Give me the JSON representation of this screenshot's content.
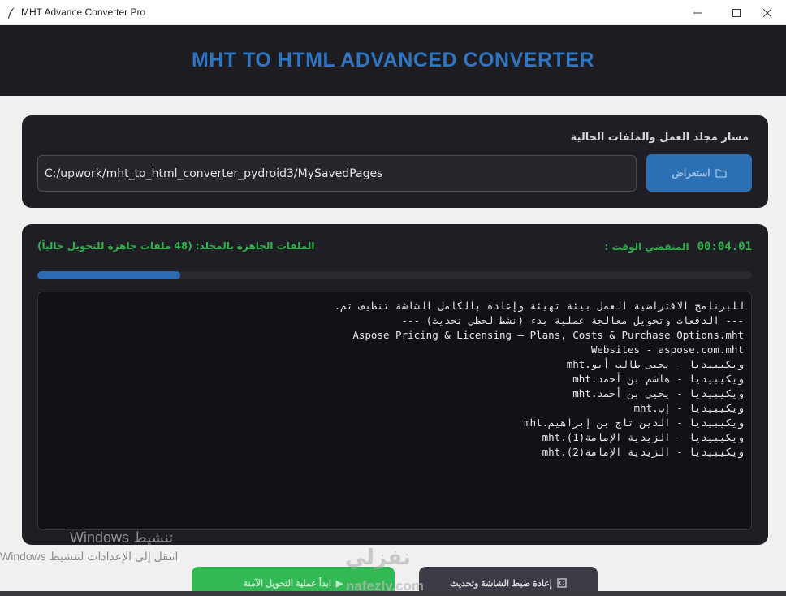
{
  "window": {
    "title": "MHT Advance Converter Pro"
  },
  "header": {
    "title": "MHT TO HTML ADVANCED CONVERTER"
  },
  "folder": {
    "label": "مسار مجلد العمل والملفات الحالية",
    "path": "C:/upwork/mht_to_html_converter_pydroid3/MySavedPages",
    "browse_label": "استعراض"
  },
  "status": {
    "files_ready": "الملفات الجاهزة بالمجلد: (48 ملفات جاهزة للتحويل حالياً)",
    "elapsed_label": "المنقضي الوقت :",
    "elapsed_time": "00:04.01",
    "progress": 0.2
  },
  "log": {
    "lines": [
      ".للبرنامج الافتراضية العمل بيئة تهيئة وإعادة بالكامل الشاشة تنظيف تم",
      "--- (نشط لحظي تحديث) الدفعات وتحويل معالجة عملية بدء ---",
      "Aspose Pricing & Licensing – Plans, Costs & Purchase Options.mht",
      "Websites - aspose.com.mht",
      "mht.ويكيبيديا - يحيى طالب أبو",
      "mht.ويكيبيديا - هاشم بن أحمد",
      "mht.ويكيبيديا - يحيى بن أحمد",
      "mht.ويكيبيديا - إب",
      "mht.ويكيبيديا - الدين تاج بن إبراهيم",
      "mht.(1)ويكيبيديا - الزيدية الإمامة",
      "mht.(2)ويكيبيديا - الزيدية الإمامة"
    ]
  },
  "actions": {
    "start_label": "ابدأ عملية التحويل الآمنة",
    "reset_label": "إعادة ضبط الشاشة وتحديث"
  },
  "watermark": {
    "activate_title": "تنشيط Windows",
    "activate_sub": "انتقل إلى الإعدادات لتنشيط Windows",
    "brand_logo": "نفزلي",
    "brand_url": "nafezly.com"
  },
  "colors": {
    "accent_blue": "#2f76c2",
    "success_green": "#2db34a",
    "card_bg": "#1e1e24"
  }
}
